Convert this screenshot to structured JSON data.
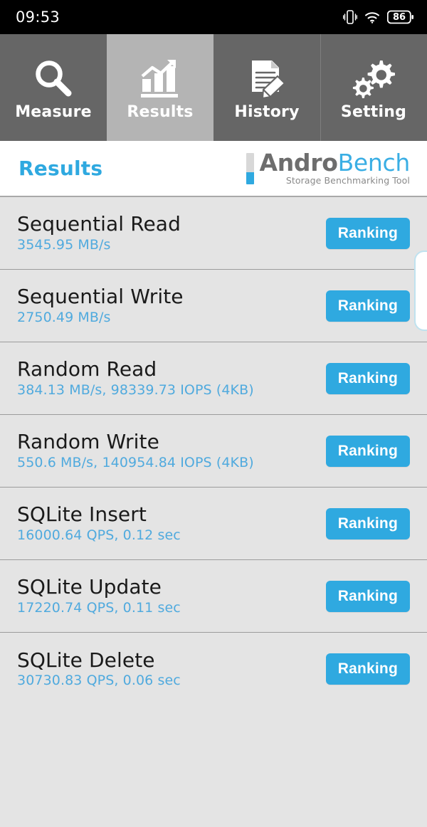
{
  "status_bar": {
    "clock": "09:53",
    "battery_level": "86",
    "icons": [
      "vibrate-icon",
      "wifi-icon",
      "battery-icon"
    ]
  },
  "tabs": [
    {
      "label": "Measure",
      "icon": "magnifier-icon",
      "active": false
    },
    {
      "label": "Results",
      "icon": "bar-chart-icon",
      "active": true
    },
    {
      "label": "History",
      "icon": "document-pencil-icon",
      "active": false
    },
    {
      "label": "Setting",
      "icon": "gears-icon",
      "active": false
    }
  ],
  "header": {
    "page_title": "Results",
    "logo_primary": "Andro",
    "logo_secondary": "Bench",
    "logo_tagline": "Storage Benchmarking Tool"
  },
  "results": [
    {
      "name": "Sequential Read",
      "value": "3545.95 MB/s",
      "action": "Ranking"
    },
    {
      "name": "Sequential Write",
      "value": "2750.49 MB/s",
      "action": "Ranking"
    },
    {
      "name": "Random Read",
      "value": "384.13 MB/s, 98339.73 IOPS (4KB)",
      "action": "Ranking"
    },
    {
      "name": "Random Write",
      "value": "550.6 MB/s, 140954.84 IOPS (4KB)",
      "action": "Ranking"
    },
    {
      "name": "SQLite Insert",
      "value": "16000.64 QPS, 0.12 sec",
      "action": "Ranking"
    },
    {
      "name": "SQLite Update",
      "value": "17220.74 QPS, 0.11 sec",
      "action": "Ranking"
    },
    {
      "name": "SQLite Delete",
      "value": "30730.83 QPS, 0.06 sec",
      "action": "Ranking"
    }
  ],
  "colors": {
    "accent_blue": "#2fa9e0",
    "value_blue": "#50aade",
    "tab_inactive": "#666666",
    "tab_active": "#b4b4b4",
    "list_background": "#e4e4e4",
    "status_bar": "#000000"
  }
}
